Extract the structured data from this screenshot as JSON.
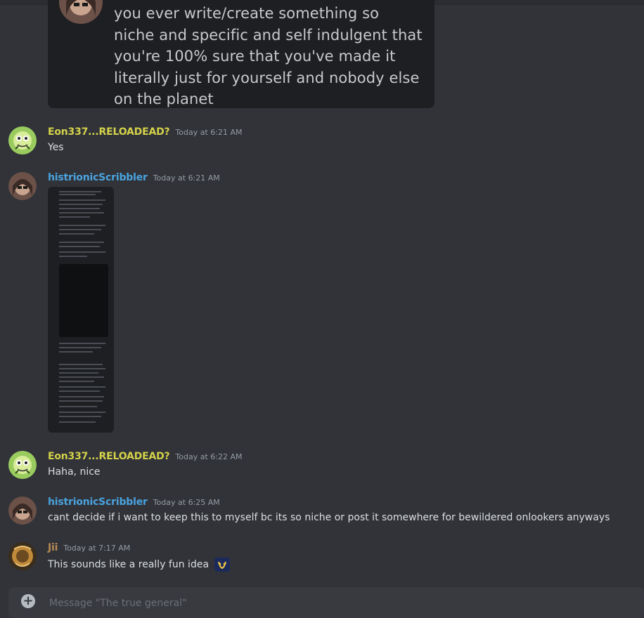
{
  "colors": {
    "eon_name": "#d4d24a",
    "histrionic_name": "#4aa3df",
    "jii_name": "#b88a57",
    "timestamp": "#949ba4",
    "background": "#313338"
  },
  "quoted": {
    "text": "you ever write/create something so niche and specific and self indulgent that you're 100% sure that you've made it literally just for yourself and nobody else on the planet"
  },
  "messages": [
    {
      "author": "Eon337...RELOADEAD?",
      "time": "Today at 6:21 AM",
      "text": "Yes"
    },
    {
      "author": "histrionicScribbler",
      "time": "Today at 6:21 AM",
      "attachment": "image"
    },
    {
      "author": "Eon337...RELOADEAD?",
      "time": "Today at 6:22 AM",
      "text": "Haha, nice"
    },
    {
      "author": "histrionicScribbler",
      "time": "Today at 6:25 AM",
      "text": "cant decide if i want to keep this to myself bc its so niche or post it somewhere for bewildered onlookers anyways"
    },
    {
      "author": "Jii",
      "time": "Today at 7:17 AM",
      "text": "This sounds like a really fun idea",
      "emoji": "custom-emoji"
    }
  ],
  "composer": {
    "placeholder": "Message \"The true general\""
  }
}
